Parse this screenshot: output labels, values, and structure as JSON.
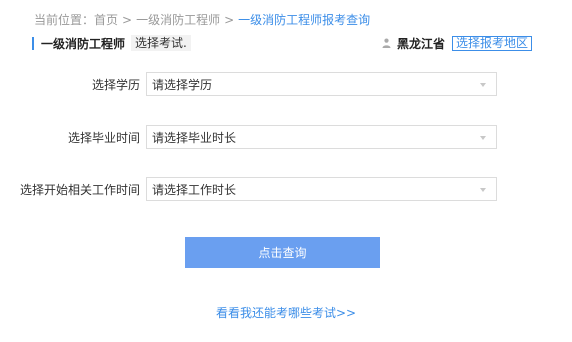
{
  "breadcrumb": {
    "prefix": "当前位置：",
    "items": [
      "首页",
      "一级消防工程师"
    ],
    "current": "一级消防工程师报考查询",
    "separator": ">"
  },
  "header": {
    "exam_name": "一级消防工程师",
    "exam_tag": "选择考试.",
    "province": "黑龙江省",
    "region_link": "选择报考地区"
  },
  "form": {
    "fields": [
      {
        "label": "选择学历",
        "value": "请选择学历"
      },
      {
        "label": "选择毕业时间",
        "value": "请选择毕业时长"
      },
      {
        "label": "选择开始相关工作时间",
        "value": "请选择工作时长"
      }
    ]
  },
  "actions": {
    "query_label": "点击查询",
    "more_link": "看看我还能考哪些考试>>"
  },
  "colors": {
    "accent": "#3c8ee8",
    "button": "#6a9ff0",
    "muted": "#999999"
  }
}
